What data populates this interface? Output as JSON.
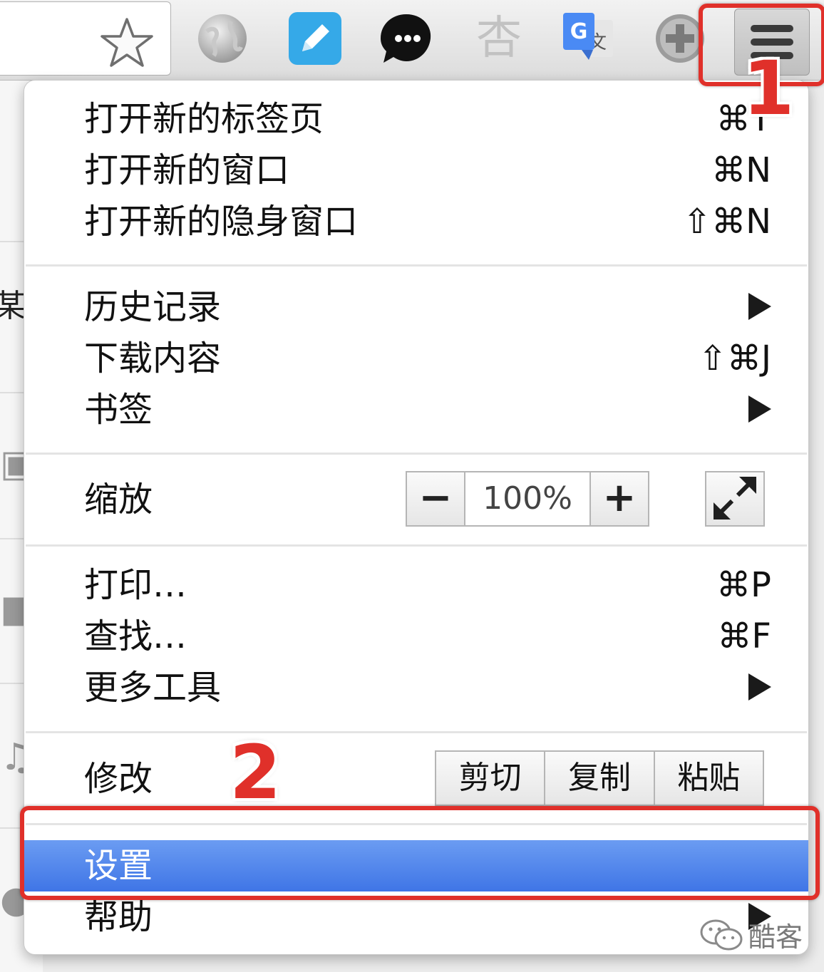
{
  "menu": {
    "groups": [
      {
        "items": [
          {
            "label": "打开新的标签页",
            "shortcut": "⌘T"
          },
          {
            "label": "打开新的窗口",
            "shortcut": "⌘N"
          },
          {
            "label": "打开新的隐身窗口",
            "shortcut": "⇧⌘N"
          }
        ]
      },
      {
        "items": [
          {
            "label": "历史记录",
            "shortcut": "",
            "submenu": true
          },
          {
            "label": "下载内容",
            "shortcut": "⇧⌘J"
          },
          {
            "label": "书签",
            "shortcut": "",
            "submenu": true
          }
        ]
      },
      {
        "zoom": {
          "label": "缩放",
          "minus": "−",
          "value": "100%",
          "plus": "+"
        }
      },
      {
        "items": [
          {
            "label": "打印…",
            "shortcut": "⌘P"
          },
          {
            "label": "查找…",
            "shortcut": "⌘F"
          },
          {
            "label": "更多工具",
            "shortcut": "",
            "submenu": true
          }
        ]
      },
      {
        "edit": {
          "label": "修改",
          "cut": "剪切",
          "copy": "复制",
          "paste": "粘贴"
        }
      },
      {
        "items": [
          {
            "label": "设置",
            "highlighted": true
          },
          {
            "label": "帮助",
            "submenu": true
          }
        ]
      }
    ]
  },
  "background": {
    "partial_text": "某"
  },
  "annotations": {
    "step1": "1",
    "step2": "2",
    "color": "#e0302a"
  },
  "toolbar": {
    "extension_icons": [
      "globe-icon",
      "note-icon",
      "chat-icon",
      "xing-icon",
      "translate-icon",
      "plus-icon"
    ],
    "ext_xing_glyph": "杏"
  },
  "watermark": {
    "text": "酷客"
  },
  "colors": {
    "highlight": "#4a7ff0"
  }
}
